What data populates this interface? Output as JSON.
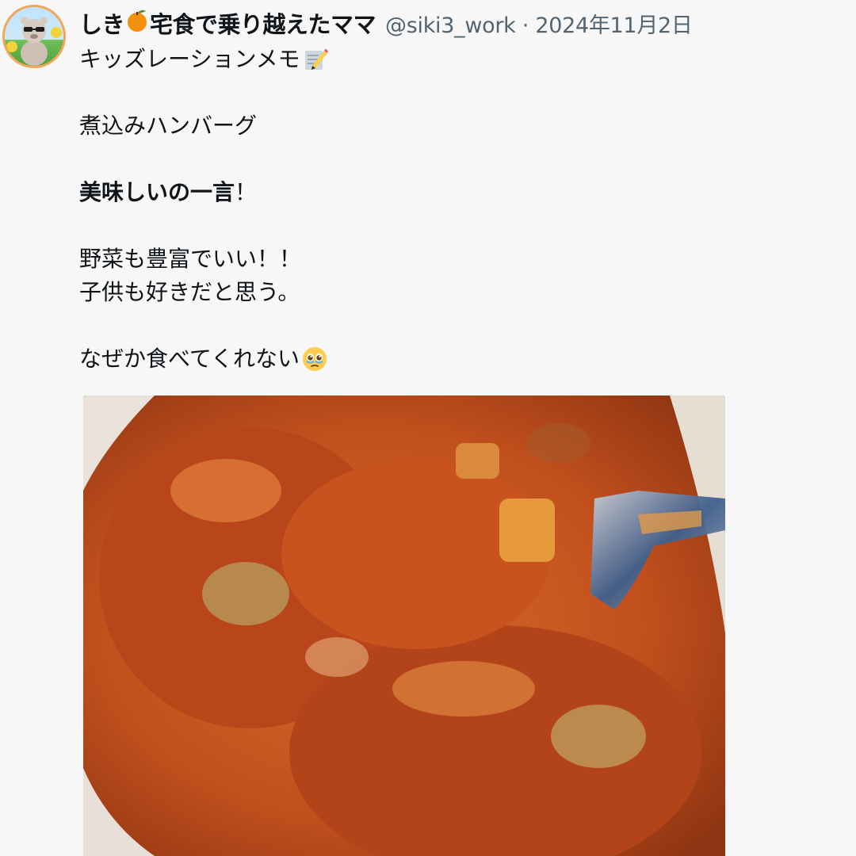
{
  "author": {
    "name_part1": "しき",
    "name_icon": "orange-emoji",
    "name_part2": "宅食で乗り越えたママ",
    "handle": "@siki3_work",
    "separator": "·",
    "date": "2024年11月2日",
    "avatar_icon": "bear-avatar"
  },
  "post": {
    "line1": "キッズレーションメモ",
    "line1_icon": "memo-emoji",
    "line2": "煮込みハンバーグ",
    "line3_bold": "美味しいの一言",
    "line3_rest": "！",
    "line4": "野菜も豊富でいい！！",
    "line5": "子供も好きだと思う。",
    "line6": "なぜか食べてくれない",
    "line6_icon": "teary-face-emoji"
  },
  "media": {
    "image_icon": "stewed-hamburg-steak-photo"
  },
  "colors": {
    "background": "#f7f7f7",
    "text": "#0f1419",
    "muted": "#536471",
    "sauce": "#c8501e"
  }
}
